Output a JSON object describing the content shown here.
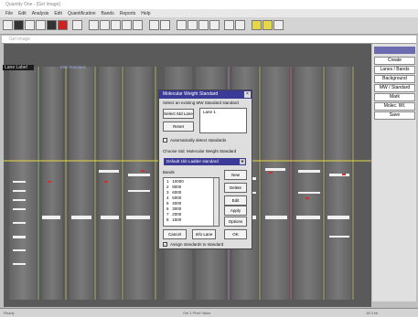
{
  "window": {
    "title": "Quantity One - [Gel Image]"
  },
  "menu": [
    "File",
    "Edit",
    "Analysis",
    "Edit",
    "Quantification",
    "Bands",
    "Reports",
    "Help"
  ],
  "document": {
    "title": "Gel Image"
  },
  "gel": {
    "lane_label": "Lane Label",
    "ref_label": "MW Standard"
  },
  "side_panel": {
    "buttons": [
      "Create",
      "Lanes / Bands",
      "Background",
      "MW / Standard",
      "Mark",
      "Molec. Wt.",
      "Save"
    ]
  },
  "dialog": {
    "title": "Molecular Weight Standard",
    "prompt": "Select an existing MW Standard standard",
    "select_std_label": "Select Std Lane",
    "reset_label": "Reset",
    "std_box_value": "Lane 1",
    "auto_label": "Automatically detect standards",
    "choose_label": "Choose Std. Molecular Weight Standard",
    "selected_standard": "Default 1kb Ladder standard",
    "bands_label": "Bands",
    "bands": [
      {
        "idx": "1",
        "val": "10000"
      },
      {
        "idx": "2",
        "val": "8000"
      },
      {
        "idx": "3",
        "val": "6000"
      },
      {
        "idx": "4",
        "val": "5000"
      },
      {
        "idx": "5",
        "val": "4000"
      },
      {
        "idx": "6",
        "val": "3000"
      },
      {
        "idx": "7",
        "val": "2000"
      },
      {
        "idx": "8",
        "val": "1500"
      }
    ],
    "buttons": {
      "new": "New",
      "delete": "Delete",
      "edit": "Edit",
      "apply": "Apply",
      "options": "Options",
      "cancel": "Cancel",
      "info": "Info Lane",
      "ok": "OK"
    },
    "assign_label": "Assign standards to standard"
  },
  "status": {
    "left": "Ready",
    "mid": "Gel 1 Pixel Value",
    "right": "18.3 kb"
  },
  "colors": {
    "accent": "#3b3b97",
    "gel_bg": "#5e5e5e",
    "band": "#f0f0f0",
    "highlight": "#e6d845"
  }
}
